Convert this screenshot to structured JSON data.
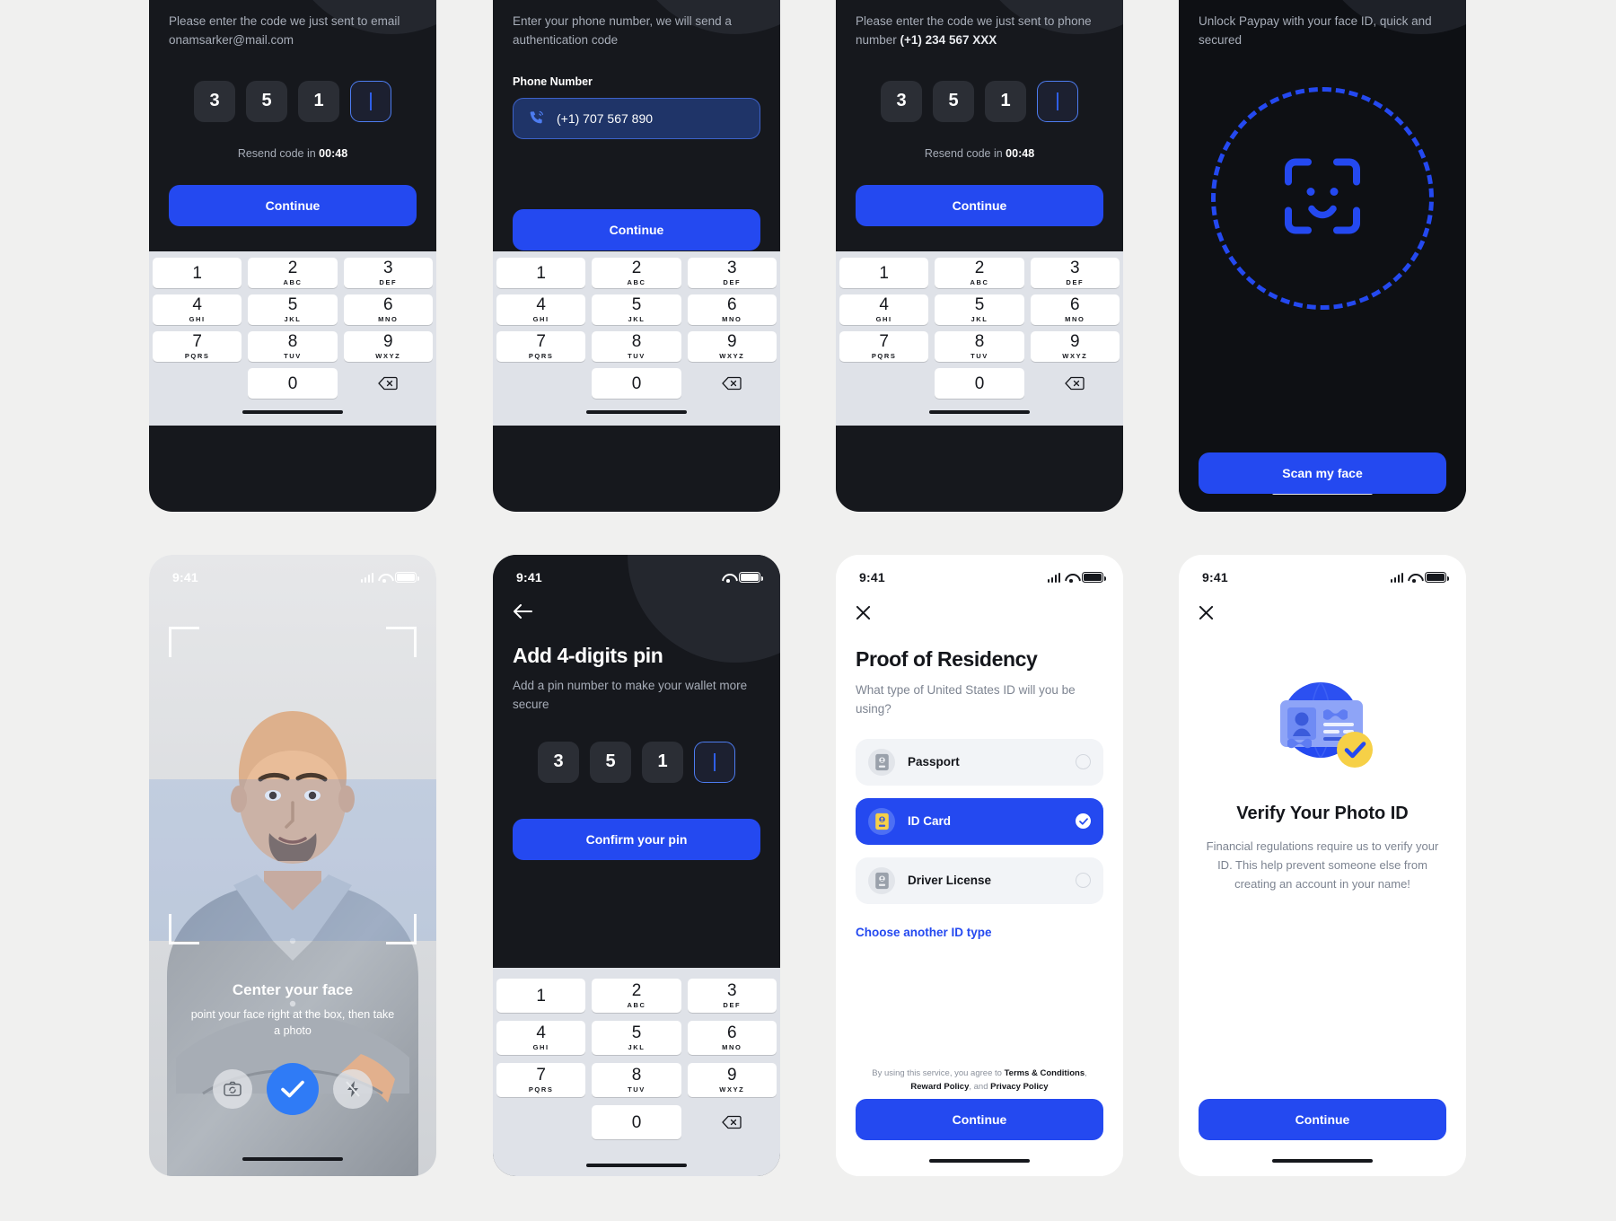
{
  "screens": {
    "email_otp": {
      "subtitle_line1": "Please enter the code we just sent to email",
      "subtitle_line2": "onamsarker@mail.com",
      "otp": [
        "3",
        "5",
        "1",
        ""
      ],
      "resend_prefix": "Resend code in ",
      "resend_timer": "00:48",
      "continue_label": "Continue"
    },
    "phone_entry": {
      "subtitle_line1": "Enter your phone number, we will send a",
      "subtitle_line2": "authentication code",
      "field_label": "Phone Number",
      "field_value": "(+1) 707 567 890",
      "phone_icon": "phone-call-icon",
      "continue_label": "Continue"
    },
    "phone_otp": {
      "subtitle_line1": "Please enter the code we just sent to phone",
      "subtitle_line2_prefix": "number ",
      "subtitle_line2_bold": "(+1) 234 567 XXX",
      "otp": [
        "3",
        "5",
        "1",
        ""
      ],
      "resend_prefix": "Resend code in ",
      "resend_timer": "00:48",
      "continue_label": "Continue"
    },
    "face_unlock": {
      "subtitle_line1": "Unlock Paypay with your face ID, quick and",
      "subtitle_line2": "secured",
      "face_icon": "face-id-icon",
      "scan_label": "Scan my face"
    },
    "camera": {
      "time": "9:41",
      "title": "Center your face",
      "hint": "point your face right at the box, then take a photo",
      "flip_icon": "camera-flip-icon",
      "confirm_icon": "check-icon",
      "flash_icon": "flash-off-icon"
    },
    "add_pin": {
      "time": "9:41",
      "back_icon": "arrow-left-icon",
      "title": "Add 4-digits pin",
      "subtitle": "Add a pin number to make your wallet more secure",
      "pin": [
        "3",
        "5",
        "1",
        ""
      ],
      "confirm_label": "Confirm your pin"
    },
    "proof_residency": {
      "time": "9:41",
      "close_icon": "close-icon",
      "title": "Proof of Residency",
      "subtitle": "What type of United States ID will you be using?",
      "options": [
        {
          "label": "Passport",
          "icon": "passport-icon",
          "selected": false
        },
        {
          "label": "ID Card",
          "icon": "id-card-icon",
          "selected": true
        },
        {
          "label": "Driver License",
          "icon": "driver-license-icon",
          "selected": false
        }
      ],
      "another_type_link": "Choose another ID type",
      "legal_prefix": "By using this service, you agree to ",
      "legal_terms": "Terms & Conditions",
      "legal_mid": ", ",
      "legal_reward": "Reward Policy",
      "legal_and": ", and ",
      "legal_privacy": "Privacy Policy",
      "continue_label": "Continue"
    },
    "verify_photo_id": {
      "time": "9:41",
      "close_icon": "close-icon",
      "illustration_icon": "id-card-verified-illustration",
      "title": "Verify Your Photo ID",
      "body": "Financial regulations require us to verify your ID. This help prevent someone else from creating an account in your name!",
      "continue_label": "Continue"
    }
  },
  "keypad": {
    "keys": [
      {
        "num": "1",
        "sub": ""
      },
      {
        "num": "2",
        "sub": "ABC"
      },
      {
        "num": "3",
        "sub": "DEF"
      },
      {
        "num": "4",
        "sub": "GHI"
      },
      {
        "num": "5",
        "sub": "JKL"
      },
      {
        "num": "6",
        "sub": "MNO"
      },
      {
        "num": "7",
        "sub": "PQRS"
      },
      {
        "num": "8",
        "sub": "TUV"
      },
      {
        "num": "9",
        "sub": "WXYZ"
      },
      {
        "num": "0",
        "sub": ""
      }
    ],
    "delete_icon": "backspace-icon"
  },
  "status_bar": {
    "time": "9:41",
    "signal_icon": "cellular-signal-icon",
    "wifi_icon": "wifi-icon",
    "battery_icon": "battery-icon"
  },
  "colors": {
    "accent_blue": "#2449f0",
    "dark_bg": "#16181d",
    "page_bg": "#f0f0ef",
    "keypad_bg": "#dfe2e8",
    "yellow": "#f6d047"
  }
}
